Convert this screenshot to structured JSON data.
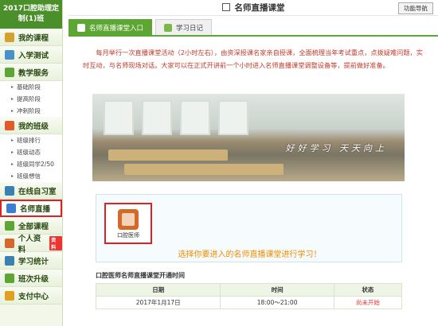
{
  "sidebar": {
    "title": "2017口腔助理定制(1)班",
    "sections": [
      {
        "label": "我的课程",
        "color": "#d4a030",
        "subs": []
      },
      {
        "label": "入学测试",
        "color": "#4a90c8",
        "subs": []
      },
      {
        "label": "教学服务",
        "color": "#5da633",
        "subs": [
          "基础阶段",
          "提高阶段",
          "冲刺阶段"
        ]
      },
      {
        "label": "我的班级",
        "color": "#e05a2a",
        "subs": [
          "班级排行",
          "班级动态",
          "班级同学2/50",
          "班级想信"
        ]
      },
      {
        "label": "在线自习室",
        "color": "#3a80b0",
        "subs": []
      },
      {
        "label": "名师直播",
        "color": "#3a7fd0",
        "subs": [],
        "active": true
      },
      {
        "label": "全部课程",
        "color": "#5da633",
        "subs": []
      },
      {
        "label": "个人资料",
        "color": "#d46a2a",
        "subs": [],
        "badge": "资料"
      },
      {
        "label": "学习统计",
        "color": "#3a80b0",
        "subs": []
      },
      {
        "label": "班次升级",
        "color": "#5da633",
        "subs": []
      },
      {
        "label": "支付中心",
        "color": "#e0a020",
        "subs": []
      }
    ]
  },
  "header": {
    "title": "名师直播课堂",
    "nav_button": "功能导航"
  },
  "tabs": [
    {
      "label": "名师直播课堂入口",
      "active": true
    },
    {
      "label": "学习日记",
      "active": false
    }
  ],
  "intro": "每月举行一次直播课堂活动（2小时左右），由资深授课名家亲自授课，全面梳理当年考试重点，点拨疑难问题，实时互动，与名师现场对话。大家可以在正式开讲前一个小时进入名师直播课堂调整设备等，提前做好准备。",
  "banner": {
    "slogan": "好好学习 天天向上"
  },
  "course": {
    "label": "口腔医师"
  },
  "choose_text": "选择你要进入的名师直播课堂进行学习！",
  "schedule": {
    "title": "口腔医师名师直播课堂开通时间",
    "headers": [
      "日期",
      "时间",
      "状态"
    ],
    "rows": [
      {
        "date": "2017年1月17日",
        "time": "18:00～21:00",
        "status": "尚未开始"
      }
    ]
  }
}
